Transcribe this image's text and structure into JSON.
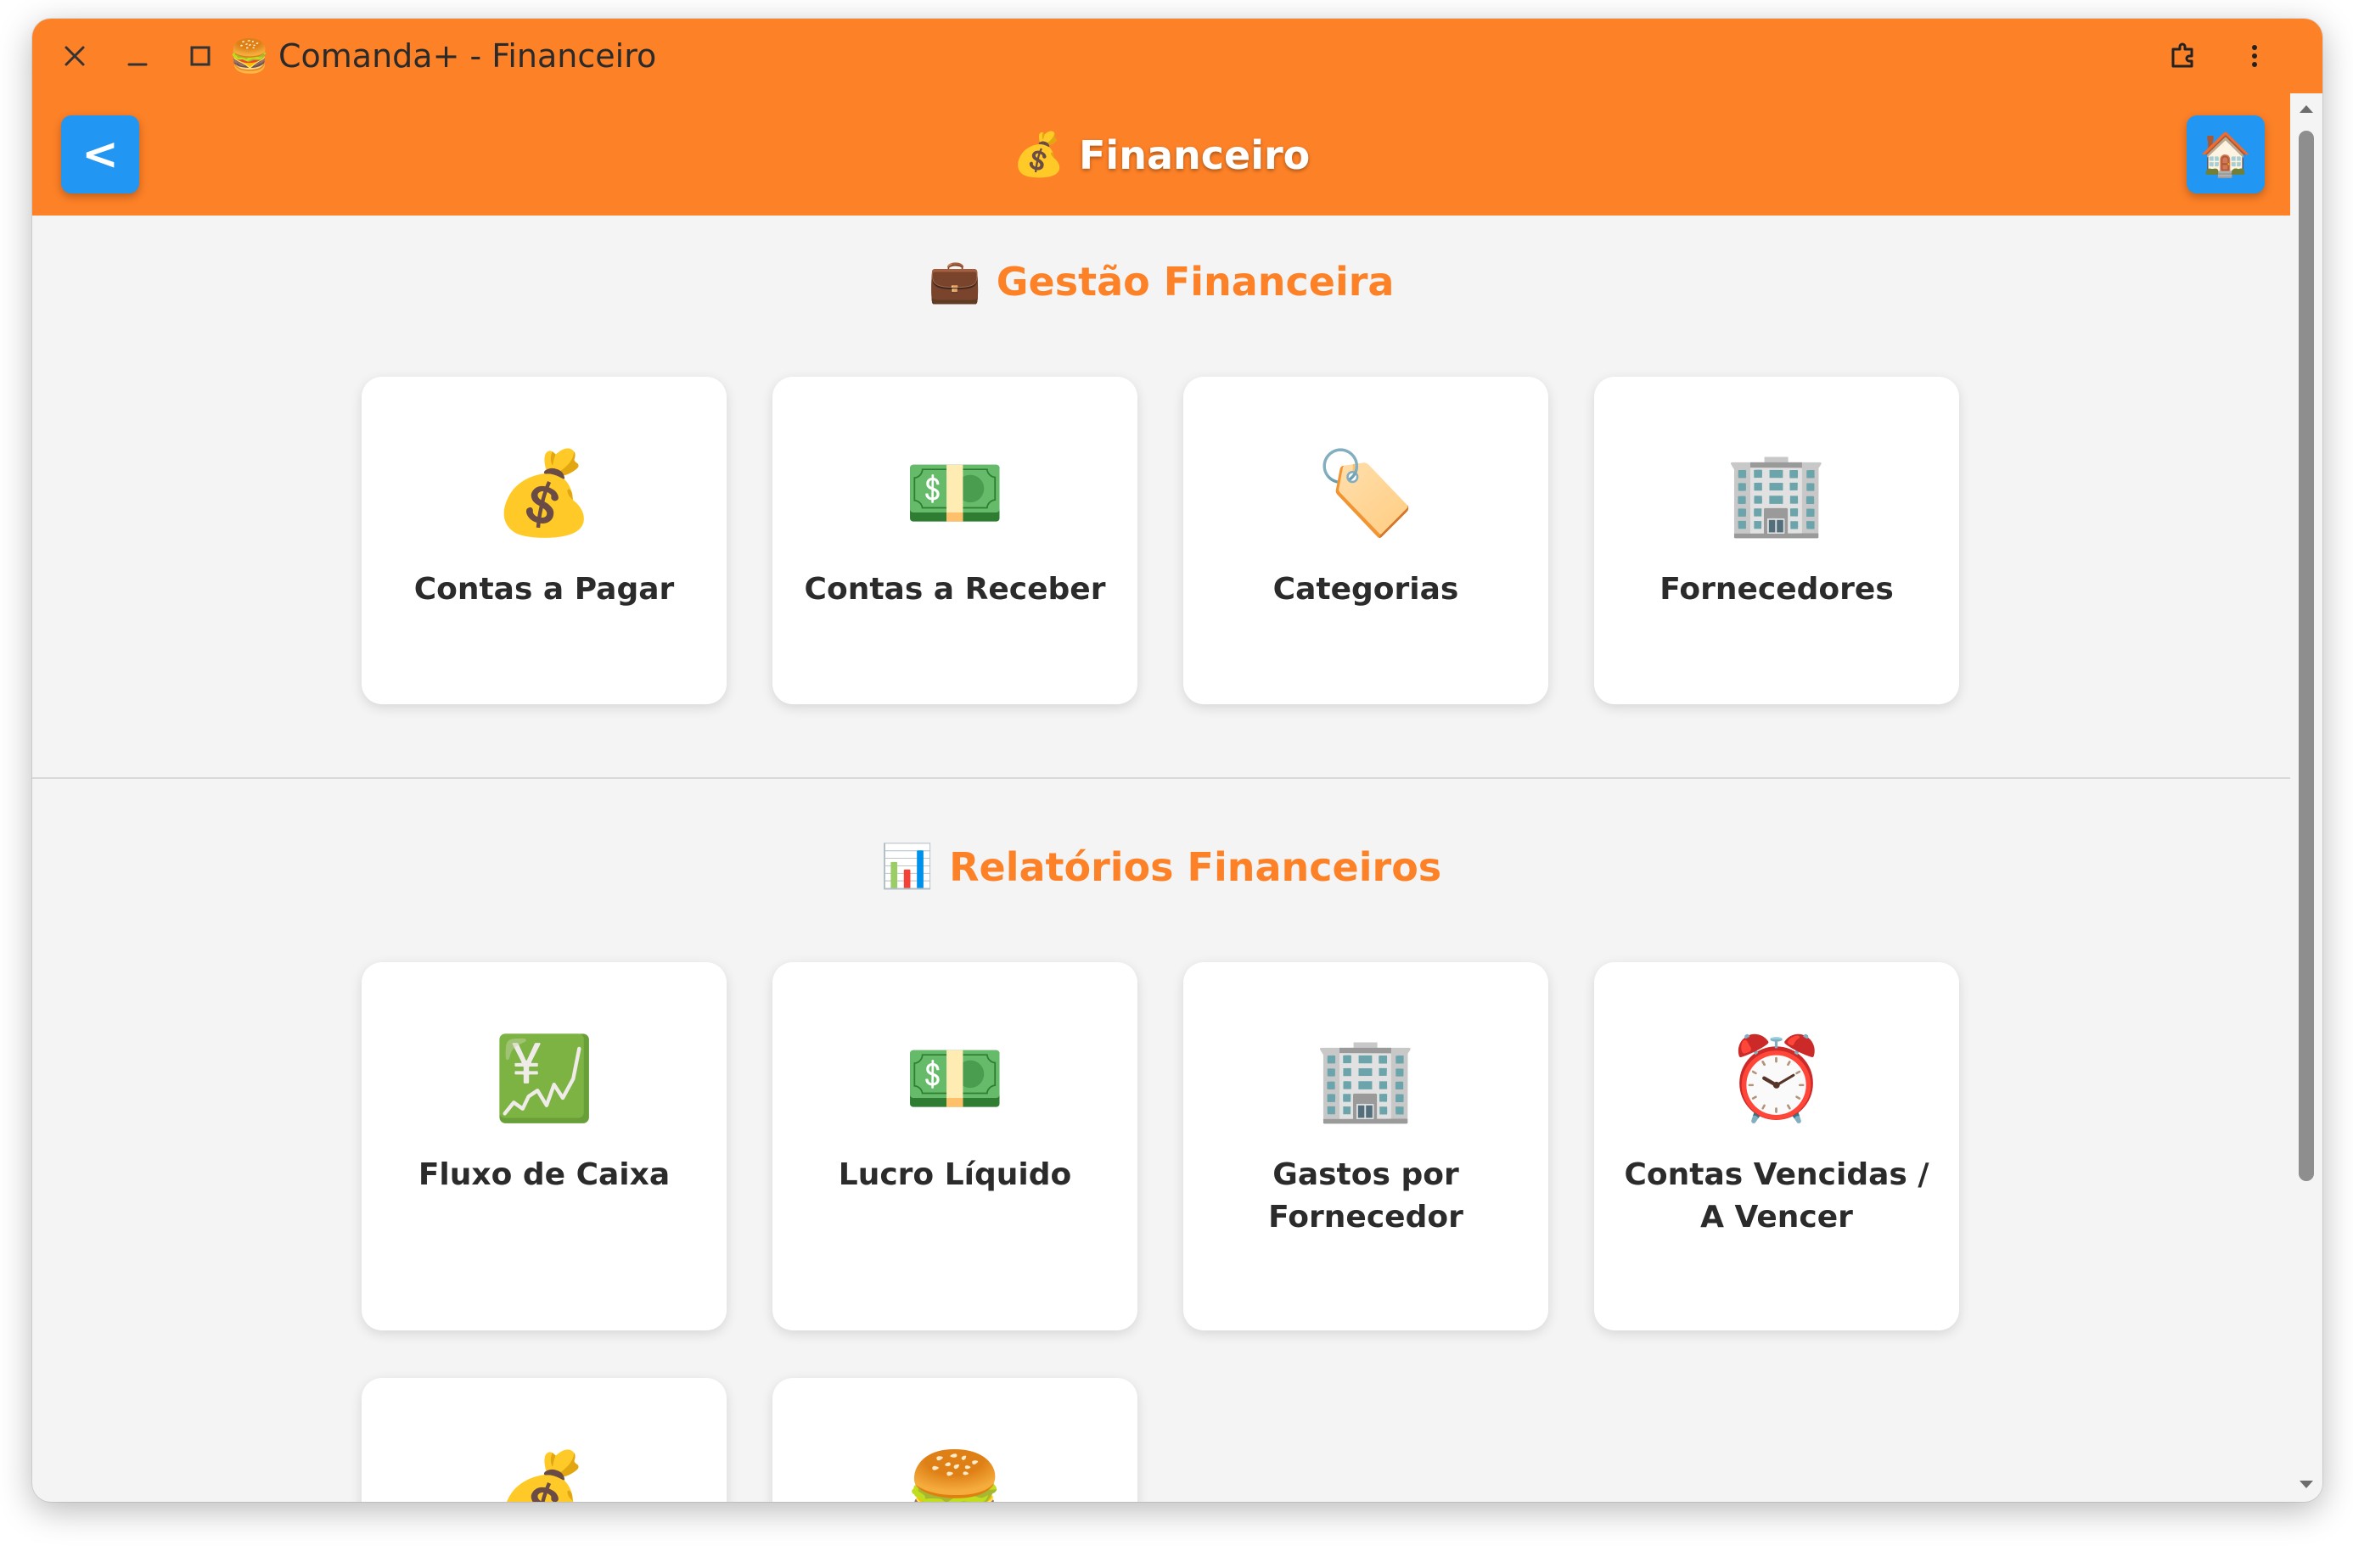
{
  "titlebar": {
    "title": "Comanda+ - Financeiro",
    "icon": "🍔",
    "icons": {
      "close": "close-icon",
      "minimize": "minimize-icon",
      "maximize": "maximize-icon",
      "extensions": "puzzle-icon",
      "menu": "kebab-menu-icon"
    }
  },
  "header": {
    "back_label": "<",
    "title_icon": "💰",
    "title": "Financeiro",
    "home_icon": "🏠"
  },
  "colors": {
    "accent": "#fd8127",
    "button": "#2196f3",
    "background": "#f4f4f4"
  },
  "sections": [
    {
      "icon": "💼",
      "title": "Gestão Financeira",
      "cards": [
        {
          "icon": "💰",
          "label": "Contas a Pagar"
        },
        {
          "icon": "💵",
          "label": "Contas a Receber"
        },
        {
          "icon": "🏷️",
          "label": "Categorias"
        },
        {
          "icon": "🏢",
          "label": "Fornecedores"
        }
      ]
    },
    {
      "icon": "📊",
      "title": "Relatórios Financeiros",
      "cards": [
        {
          "icon": "💹",
          "label": "Fluxo de Caixa"
        },
        {
          "icon": "💵",
          "label": "Lucro Líquido"
        },
        {
          "icon": "🏢",
          "label": "Gastos por Fornecedor"
        },
        {
          "icon": "⏰",
          "label": "Contas Vencidas / A Vencer"
        },
        {
          "icon": "💰",
          "label": ""
        },
        {
          "icon": "🍔",
          "label": ""
        }
      ]
    }
  ]
}
